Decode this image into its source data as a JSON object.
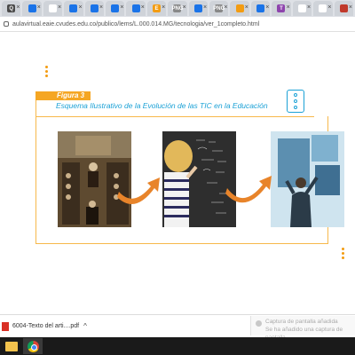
{
  "browser": {
    "tabs": [
      {
        "icon": "q-favicon",
        "label": "Q",
        "color": "#4a4a4a"
      },
      {
        "icon": "doc-favicon",
        "label": "",
        "color": "#1a73e8"
      },
      {
        "icon": "doc-favicon",
        "label": "",
        "color": "#ffffff"
      },
      {
        "icon": "doc-favicon",
        "label": "",
        "color": "#1a73e8"
      },
      {
        "icon": "doc-favicon",
        "label": "",
        "color": "#1a73e8"
      },
      {
        "icon": "doc-favicon",
        "label": "",
        "color": "#1a73e8"
      },
      {
        "icon": "doc-favicon",
        "label": "",
        "color": "#1a73e8"
      },
      {
        "icon": "e-favicon",
        "label": "E",
        "color": "#f39c12"
      },
      {
        "icon": "png-favicon",
        "label": "PNG",
        "color": "#888888"
      },
      {
        "icon": "doc-favicon",
        "label": "",
        "color": "#1a73e8"
      },
      {
        "icon": "png-favicon",
        "label": "PNG",
        "color": "#888888"
      },
      {
        "icon": "multi-favicon",
        "label": "",
        "color": "#f39c12"
      },
      {
        "icon": "doc-favicon",
        "label": "",
        "color": "#1a73e8"
      },
      {
        "icon": "t-favicon",
        "label": "T",
        "color": "#8e44ad"
      },
      {
        "icon": "doc-favicon",
        "label": "",
        "color": "#ffffff"
      },
      {
        "icon": "doc-favicon",
        "label": "",
        "color": "#ffffff"
      },
      {
        "icon": "red-favicon",
        "label": "",
        "color": "#c0392b"
      }
    ],
    "url": "aulavirtual.eaie.cvudes.edu.co/publico/lems/L.000.014.MG/tecnologia/ver_1completo.html"
  },
  "figure": {
    "label": "Figura 3",
    "caption": "Esquema Ilustrativo de la Evolución de las TIC en la Educación",
    "accent_color": "#f5a623",
    "caption_color": "#1ba1d6",
    "images": [
      {
        "name": "historical-classroom-image"
      },
      {
        "name": "child-at-chalkboard-image"
      },
      {
        "name": "person-touchscreen-image"
      }
    ]
  },
  "downloads": {
    "file_name": "6004-Texto del arti....pdf",
    "caret": "^"
  },
  "toast": {
    "title": "Captura de pantalla añadida",
    "subtitle": "Se ha añadido una captura de pantalla"
  }
}
